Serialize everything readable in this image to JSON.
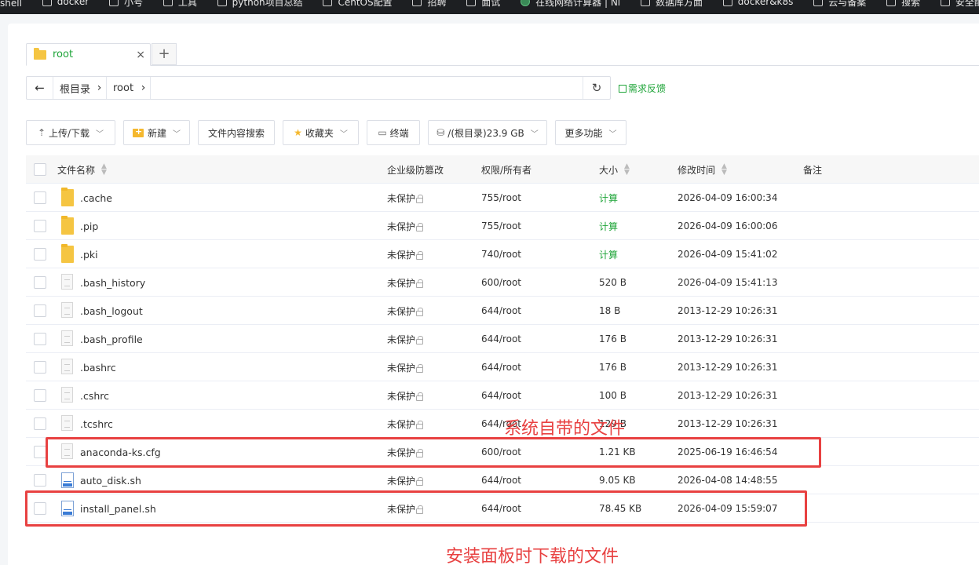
{
  "bookmarks": [
    "shell",
    "docker",
    "小号",
    "工具",
    "python项目总结",
    "CentOS配置",
    "招聘",
    "面试",
    "在线网络计算器 | Ni",
    "数据库方面",
    "docker&k8s",
    "云与备案",
    "搜索",
    "安全配置"
  ],
  "tab": {
    "label": "root",
    "close": "×",
    "add": "+"
  },
  "path": {
    "back": "←",
    "crumbs": [
      "根目录",
      "root"
    ],
    "sep": "›",
    "refresh": "↻"
  },
  "feedback": "需求反馈",
  "toolbar": {
    "upload": "上传/下载",
    "new": "新建",
    "search": "文件内容搜索",
    "favorites": "收藏夹",
    "terminal": "终端",
    "disk": "/(根目录)23.9 GB",
    "more": "更多功能"
  },
  "columns": {
    "name": "文件名称",
    "tamper": "企业级防篡改",
    "perm": "权限/所有者",
    "size": "大小",
    "mtime": "修改时间",
    "note": "备注"
  },
  "files": [
    {
      "name": ".cache",
      "type": "folder",
      "tamper": "未保护",
      "perm": "755/root",
      "size": "计算",
      "mtime": "2026-04-09 16:00:34"
    },
    {
      "name": ".pip",
      "type": "folder",
      "tamper": "未保护",
      "perm": "755/root",
      "size": "计算",
      "mtime": "2026-04-09 16:00:06"
    },
    {
      "name": ".pki",
      "type": "folder",
      "tamper": "未保护",
      "perm": "740/root",
      "size": "计算",
      "mtime": "2026-04-09 15:41:02"
    },
    {
      "name": ".bash_history",
      "type": "file",
      "tamper": "未保护",
      "perm": "600/root",
      "size": "520 B",
      "mtime": "2026-04-09 15:41:13"
    },
    {
      "name": ".bash_logout",
      "type": "file",
      "tamper": "未保护",
      "perm": "644/root",
      "size": "18 B",
      "mtime": "2013-12-29 10:26:31"
    },
    {
      "name": ".bash_profile",
      "type": "file",
      "tamper": "未保护",
      "perm": "644/root",
      "size": "176 B",
      "mtime": "2013-12-29 10:26:31"
    },
    {
      "name": ".bashrc",
      "type": "file",
      "tamper": "未保护",
      "perm": "644/root",
      "size": "176 B",
      "mtime": "2013-12-29 10:26:31"
    },
    {
      "name": ".cshrc",
      "type": "file",
      "tamper": "未保护",
      "perm": "644/root",
      "size": "100 B",
      "mtime": "2013-12-29 10:26:31"
    },
    {
      "name": ".tcshrc",
      "type": "file",
      "tamper": "未保护",
      "perm": "644/root",
      "size": "129 B",
      "mtime": "2013-12-29 10:26:31"
    },
    {
      "name": "anaconda-ks.cfg",
      "type": "file",
      "tamper": "未保护",
      "perm": "600/root",
      "size": "1.21 KB",
      "mtime": "2025-06-19 16:46:54"
    },
    {
      "name": "auto_disk.sh",
      "type": "shell",
      "tamper": "未保护",
      "perm": "644/root",
      "size": "9.05 KB",
      "mtime": "2026-04-08 14:48:55"
    },
    {
      "name": "install_panel.sh",
      "type": "shell",
      "tamper": "未保护",
      "perm": "644/root",
      "size": "78.45 KB",
      "mtime": "2026-04-09 15:59:07"
    }
  ],
  "annotations": {
    "system": "系统自带的文件",
    "panel": "安装面板时下载的文件"
  },
  "colors": {
    "accent": "#20a53a",
    "annotation": "#e84141"
  }
}
